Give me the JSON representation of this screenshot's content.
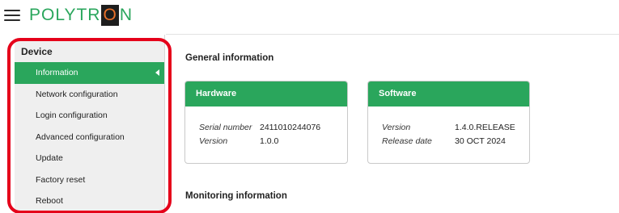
{
  "header": {
    "logo_pre": "POLYTR",
    "logo_o": "O",
    "logo_post": "N"
  },
  "sidebar": {
    "title": "Device",
    "items": [
      {
        "label": "Information",
        "active": true
      },
      {
        "label": "Network configuration"
      },
      {
        "label": "Login configuration"
      },
      {
        "label": "Advanced configuration"
      },
      {
        "label": "Update"
      },
      {
        "label": "Factory reset"
      },
      {
        "label": "Reboot"
      }
    ]
  },
  "main": {
    "general_title": "General information",
    "hardware": {
      "title": "Hardware",
      "rows": [
        {
          "key": "Serial number",
          "value": "2411010244076"
        },
        {
          "key": "Version",
          "value": "1.0.0"
        }
      ]
    },
    "software": {
      "title": "Software",
      "rows": [
        {
          "key": "Version",
          "value": "1.4.0.RELEASE"
        },
        {
          "key": "Release date",
          "value": "30 OCT 2024"
        }
      ]
    },
    "monitoring_title": "Monitoring information"
  },
  "colors": {
    "brand_green": "#2aa65c",
    "highlight_red": "#e5001a",
    "logo_accent": "#e8702a"
  }
}
